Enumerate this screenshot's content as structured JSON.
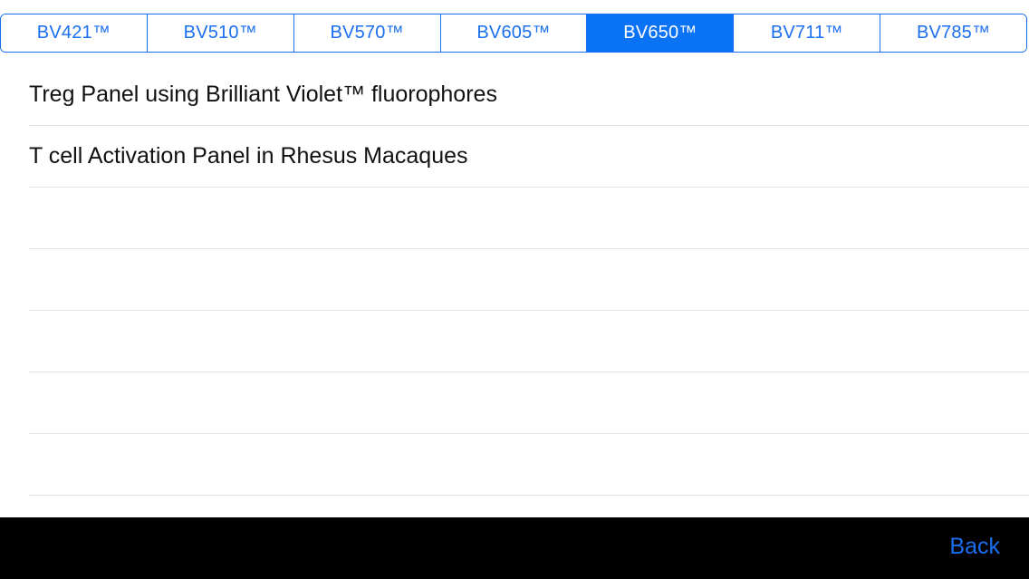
{
  "tabs": [
    {
      "label": "BV421™",
      "selected": false
    },
    {
      "label": "BV510™",
      "selected": false
    },
    {
      "label": "BV570™",
      "selected": false
    },
    {
      "label": "BV605™",
      "selected": false
    },
    {
      "label": "BV650™",
      "selected": true
    },
    {
      "label": "BV711™",
      "selected": false
    },
    {
      "label": "BV785™",
      "selected": false
    }
  ],
  "list": {
    "items": [
      {
        "label": "Treg Panel using Brilliant Violet™ fluorophores"
      },
      {
        "label": "T cell Activation Panel in Rhesus Macaques"
      },
      {
        "label": ""
      },
      {
        "label": ""
      },
      {
        "label": ""
      },
      {
        "label": ""
      },
      {
        "label": ""
      }
    ]
  },
  "footer": {
    "back_label": "Back"
  },
  "colors": {
    "accent": "#1a6ff0",
    "selected_bg": "#0a72f5",
    "bottom_bar": "#000000"
  }
}
